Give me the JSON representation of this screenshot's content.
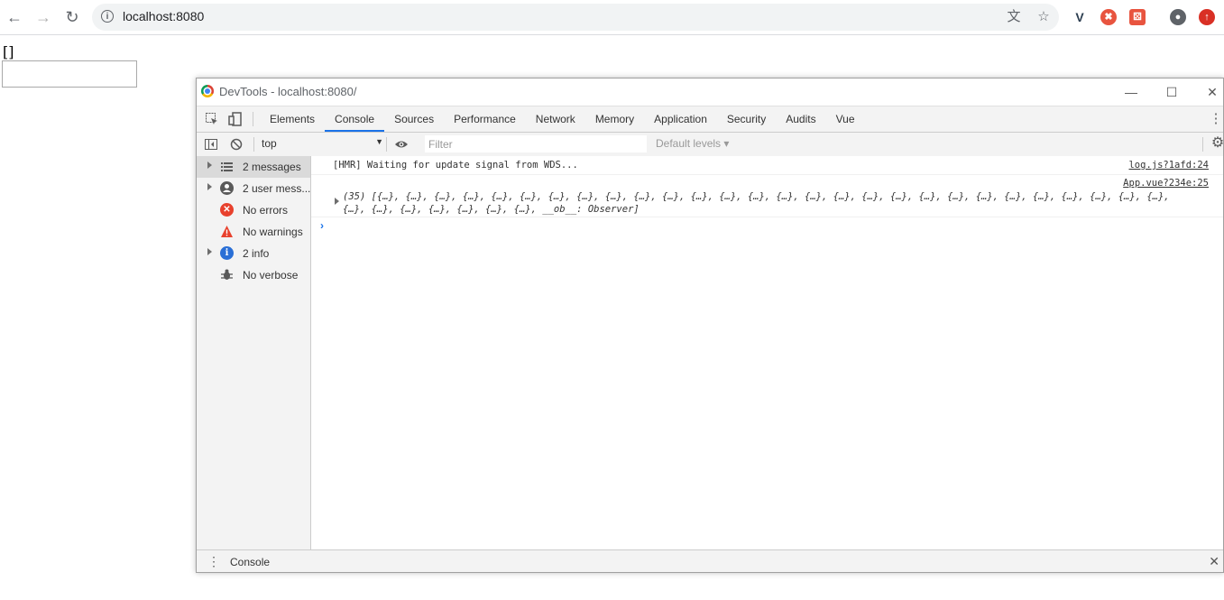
{
  "browser": {
    "url": "localhost:8080",
    "back_icon": "←",
    "forward_icon": "→",
    "reload_icon": "↻",
    "info_icon": "i",
    "translate_icon": "文",
    "star_icon": "☆",
    "extensions": [
      "vue-devtools-icon",
      "red-x-extension-icon",
      "red-dice-extension-icon",
      "profile-avatar-icon",
      "update-arrow-icon"
    ],
    "ext_glyphs": [
      "V",
      "✖",
      "⚄",
      "●",
      "↑"
    ]
  },
  "page": {
    "output_text": "[]",
    "input_value": ""
  },
  "devtools": {
    "window_title": "DevTools - localhost:8080/",
    "minimize_glyph": "—",
    "maximize_glyph": "☐",
    "close_glyph": "✕",
    "tabs": [
      "Elements",
      "Console",
      "Sources",
      "Performance",
      "Network",
      "Memory",
      "Application",
      "Security",
      "Audits",
      "Vue"
    ],
    "active_tab": "Console",
    "more_glyph": "⋮",
    "toolbar": {
      "context": "top",
      "context_arrow": "▼",
      "filter_placeholder": "Filter",
      "levels": "Default levels ▾",
      "settings_glyph": "⚙",
      "eye_glyph": "👁",
      "clear_glyph": "⃠"
    },
    "sidebar": [
      {
        "label": "2 messages",
        "icon": "list-icon",
        "expandable": true,
        "selected": true
      },
      {
        "label": "2 user mess...",
        "icon": "user-icon",
        "expandable": true,
        "selected": false
      },
      {
        "label": "No errors",
        "icon": "error-icon",
        "expandable": false,
        "selected": false
      },
      {
        "label": "No warnings",
        "icon": "warning-icon",
        "expandable": false,
        "selected": false
      },
      {
        "label": "2 info",
        "icon": "info-icon",
        "expandable": true,
        "selected": false
      },
      {
        "label": "No verbose",
        "icon": "bug-icon",
        "expandable": false,
        "selected": false
      }
    ],
    "messages": [
      {
        "text": "[HMR] Waiting for update signal from WDS...",
        "source": "log.js?1afd:24"
      },
      {
        "text_line1": "(35) [{…}, {…}, {…}, {…}, {…}, {…}, {…}, {…}, {…}, {…}, {…}, {…}, {…}, {…}, {…}, {…}, {…}, {…}, {…}, {…}, {…}, {…}, {…}, {…}, {…}, {…}, {…}, {…},",
        "text_line2": "{…}, {…}, {…}, {…}, {…}, {…}, {…}, __ob__: Observer]",
        "source": "App.vue?234e:25"
      }
    ],
    "prompt_glyph": "›",
    "drawer": {
      "menu_glyph": "⋮",
      "tab": "Console",
      "close_glyph": "✕"
    }
  }
}
